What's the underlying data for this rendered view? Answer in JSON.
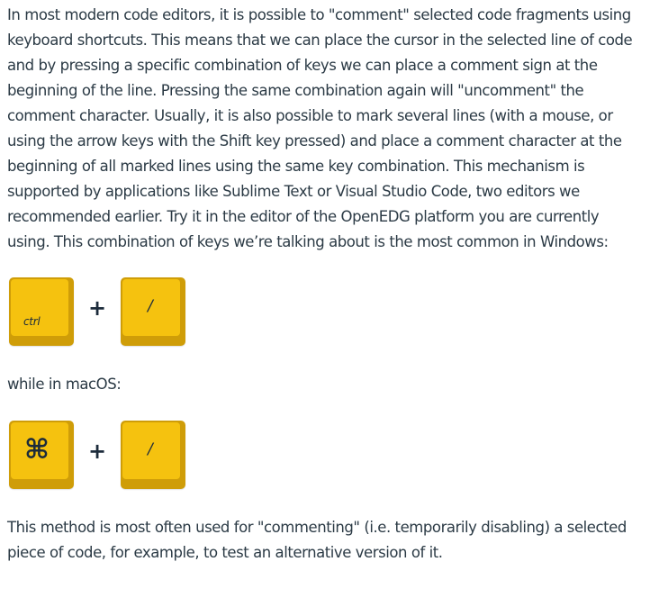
{
  "intro_lines": [
    "In most modern code editors, it is possible to \"comment\" selected code fragments using",
    "keyboard shortcuts. This means that we can place the cursor in the selected line of code",
    "and by pressing a specific combination of keys we can place a comment sign at the",
    "beginning of the line. Pressing the same combination again will \"uncomment\" the",
    "comment character. Usually, it is also possible to mark several lines (with a mouse, or",
    "using the arrow keys with the Shift key pressed) and place a comment character at the",
    "beginning of all marked lines using the same key combination. This mechanism is",
    "supported by applications like Sublime Text or Visual Studio Code, two editors we",
    "recommended earlier. Try it in the editor of the OpenEDG platform you are currently",
    "using. This combination of keys we’re talking about is the most common in Windows:"
  ],
  "windows_shortcut": {
    "modifier_key": "ctrl",
    "plus": "+",
    "main_key": "/"
  },
  "mac_intro": "while in macOS:",
  "mac_shortcut": {
    "modifier_key": "⌘",
    "plus": "+",
    "main_key": "/"
  },
  "closing_lines": [
    "This method is most often used for \"commenting\" (i.e. temporarily disabling) a selected",
    "piece of code, for example, to test an alternative version of it."
  ],
  "colors": {
    "text": "#2b3a45",
    "key_face": "#f5c20f",
    "key_edge": "#cf9d08",
    "key_label": "#1c2b3b"
  }
}
